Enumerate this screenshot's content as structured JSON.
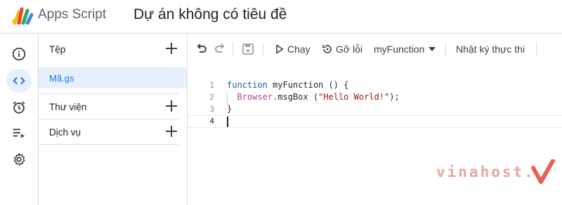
{
  "header": {
    "app_name": "Apps Script",
    "project_title": "Dự án không có tiêu đề"
  },
  "rail": {
    "items": [
      {
        "icon": "info-icon",
        "active": false
      },
      {
        "icon": "code-editor-icon",
        "active": true
      },
      {
        "icon": "alarm-clock-icon",
        "active": false
      },
      {
        "icon": "executions-icon",
        "active": false
      },
      {
        "icon": "gear-icon",
        "active": false
      }
    ]
  },
  "files_panel": {
    "files_label": "Tệp",
    "active_file": "Mã.gs",
    "libraries_label": "Thư viện",
    "services_label": "Dịch vụ"
  },
  "toolbar": {
    "run_label": "Chạy",
    "debug_label": "Gỡ lỗi",
    "function_selected": "myFunction",
    "log_label": "Nhật ký thực thi"
  },
  "editor": {
    "line_numbers": [
      "1",
      "2",
      "3",
      "4"
    ],
    "current_line": 4,
    "lines": [
      {
        "keyword": "function",
        "rest": " myFunction () {"
      },
      {
        "indent": "  ",
        "object": "Browser",
        "method": ".msgBox (",
        "string": "\"Hello World!\"",
        "end": ");"
      },
      {
        "text": "}"
      },
      {
        "text": ""
      }
    ]
  },
  "watermark": {
    "text": "vinahost."
  },
  "colors": {
    "accent": "#1a73e8",
    "active_bg": "#e8f0fe",
    "border": "#dadce0",
    "watermark": "#e9a49c",
    "watermark_check": "#e66352"
  }
}
